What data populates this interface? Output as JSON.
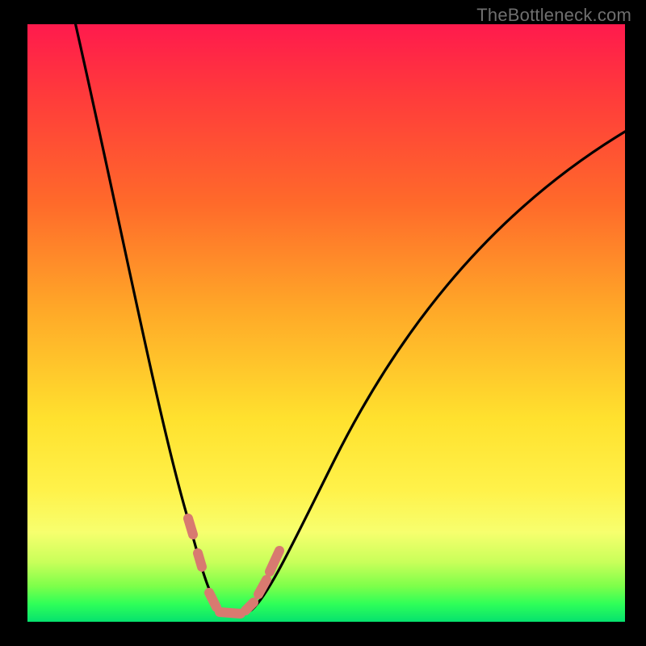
{
  "watermark": "TheBottleneck.com",
  "chart_data": {
    "type": "line",
    "title": "",
    "xlabel": "",
    "ylabel": "",
    "xlim": [
      0,
      100
    ],
    "ylim": [
      0,
      100
    ],
    "series": [
      {
        "name": "bottleneck-curve",
        "x": [
          0,
          5,
          10,
          15,
          20,
          25,
          28,
          30,
          32,
          34,
          36,
          38,
          42,
          48,
          55,
          65,
          75,
          85,
          95,
          100
        ],
        "values": [
          102,
          85,
          68,
          50,
          34,
          18,
          10,
          5,
          2,
          1,
          1,
          2,
          5,
          12,
          22,
          38,
          54,
          68,
          79,
          84
        ]
      }
    ],
    "highlight_band": {
      "x_start": 26,
      "x_end": 40,
      "note": "bottom-of-curve markers"
    },
    "gradient_stops": [
      {
        "pos": 0,
        "color": "#ff1a4d"
      },
      {
        "pos": 30,
        "color": "#ff6a2a"
      },
      {
        "pos": 66,
        "color": "#ffe12e"
      },
      {
        "pos": 90,
        "color": "#c9ff5a"
      },
      {
        "pos": 100,
        "color": "#06e26e"
      }
    ],
    "colors": {
      "curve": "#000000",
      "marker": "#d87a70",
      "frame": "#000000"
    }
  }
}
